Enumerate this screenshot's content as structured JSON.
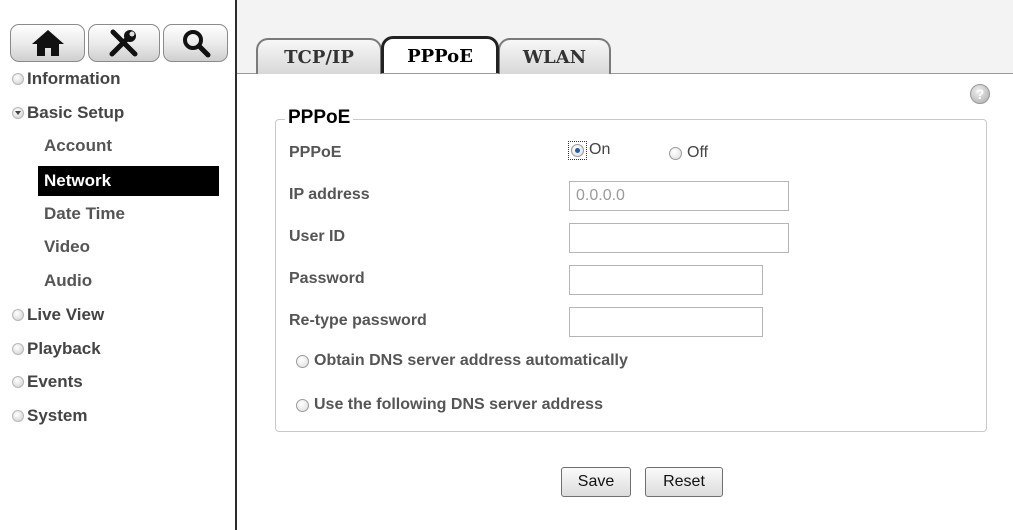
{
  "toolbar": {
    "home_icon": "home-icon",
    "tools_icon": "tools-icon",
    "search_icon": "search-icon"
  },
  "sidebar": {
    "groups": [
      {
        "label": "Information",
        "expanded": false
      },
      {
        "label": "Basic Setup",
        "expanded": true
      },
      {
        "label": "Live View",
        "expanded": false
      },
      {
        "label": "Playback",
        "expanded": false
      },
      {
        "label": "Events",
        "expanded": false
      },
      {
        "label": "System",
        "expanded": false
      }
    ],
    "submenu": [
      {
        "label": "Account",
        "active": false
      },
      {
        "label": "Network",
        "active": true
      },
      {
        "label": "Date Time",
        "active": false
      },
      {
        "label": "Video",
        "active": false
      },
      {
        "label": "Audio",
        "active": false
      }
    ]
  },
  "tabs": [
    {
      "label": "TCP/IP",
      "active": false
    },
    {
      "label": "PPPoE",
      "active": true
    },
    {
      "label": "WLAN",
      "active": false
    }
  ],
  "help_icon": "question-icon",
  "form": {
    "legend": "PPPoE",
    "pppoe_label": "PPPoE",
    "pppoe_on": "On",
    "pppoe_off": "Off",
    "pppoe_value": "On",
    "ip_label": "IP address",
    "ip_value": "0.0.0.0",
    "userid_label": "User ID",
    "userid_value": "",
    "password_label": "Password",
    "password_value": "",
    "retype_label": "Re-type password",
    "retype_value": "",
    "dns_auto": "Obtain DNS server address automatically",
    "dns_manual": "Use the following DNS server address"
  },
  "buttons": {
    "save": "Save",
    "reset": "Reset"
  },
  "colors": {
    "active_menu_bg": "#000000",
    "radio_selected": "#1a5fbf"
  }
}
